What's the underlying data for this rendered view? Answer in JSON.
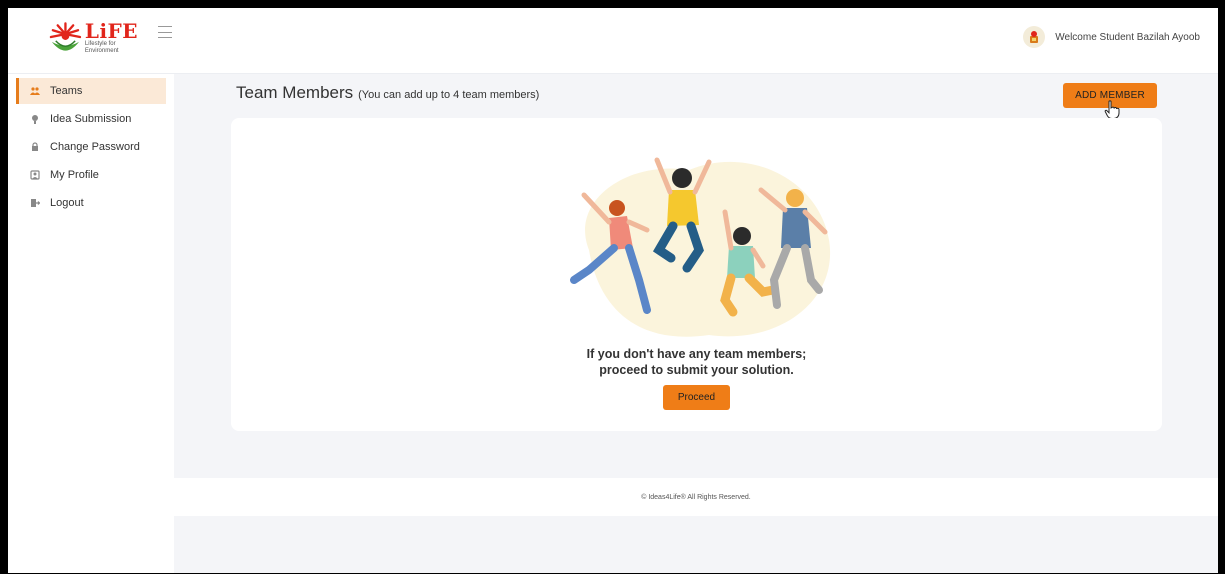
{
  "header": {
    "logo_title": "LiFE",
    "logo_subtitle_line1": "Lifestyle for",
    "logo_subtitle_line2": "Environment",
    "welcome_text": "Welcome Student Bazilah Ayoob"
  },
  "sidebar": {
    "items": [
      {
        "label": "Teams",
        "icon": "team-icon",
        "active": true
      },
      {
        "label": "Idea Submission",
        "icon": "bulb-icon",
        "active": false
      },
      {
        "label": "Change Password",
        "icon": "lock-icon",
        "active": false
      },
      {
        "label": "My Profile",
        "icon": "profile-icon",
        "active": false
      },
      {
        "label": "Logout",
        "icon": "logout-icon",
        "active": false
      }
    ]
  },
  "main": {
    "title": "Team Members",
    "subtitle": "(You can add up to 4 team members)",
    "add_member_label": "ADD MEMBER",
    "empty_line1": "If you don't have any team members;",
    "empty_line2": "proceed to submit your solution.",
    "proceed_label": "Proceed"
  },
  "footer": {
    "text": "© Ideas4Life® All Rights Reserved."
  },
  "colors": {
    "accent": "#ef7d17",
    "active_bg": "#fbe9d7",
    "brand_red": "#e1251b"
  }
}
